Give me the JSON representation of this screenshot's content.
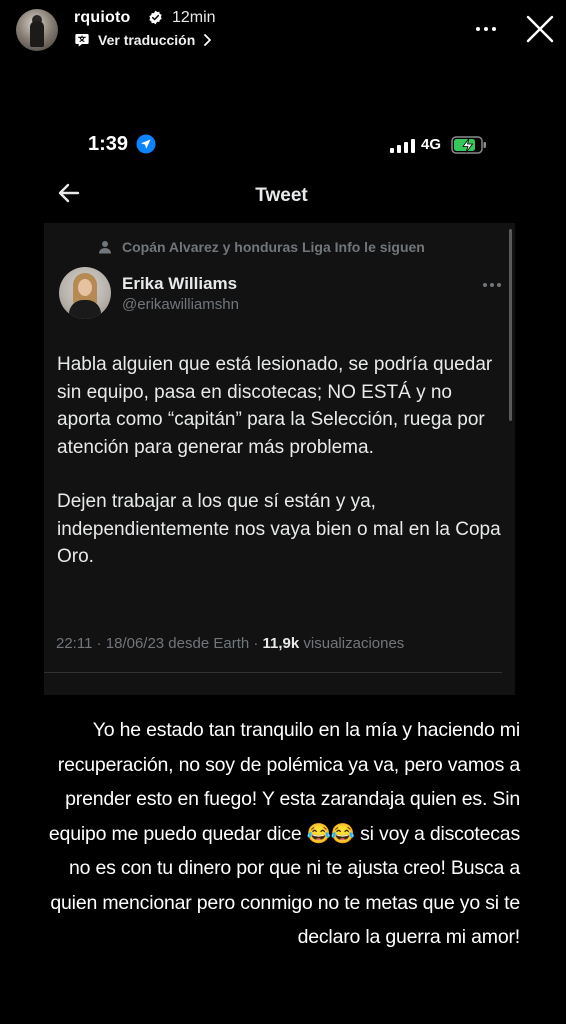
{
  "story": {
    "username": "rquioto",
    "time": "12min",
    "translate_label": "Ver traducción",
    "icons": [
      "verified-icon",
      "translate-icon",
      "chevron-right-icon",
      "more-icon",
      "close-icon"
    ]
  },
  "screenshot": {
    "status_bar": {
      "time": "1:39",
      "network": "4G"
    },
    "nav": {
      "title": "Tweet"
    },
    "tweet": {
      "social_context": "Copán Alvarez y honduras Liga Info le siguen",
      "author_name": "Erika Williams",
      "author_handle": "@erikawilliamshn",
      "body": [
        "Habla alguien que está lesionado, se podría quedar sin equipo, pasa en discotecas; NO ESTÁ y no aporta como “capitán” para la Selección, ruega por atención para generar más problema.",
        "Dejen trabajar a los que sí están y ya, independientemente nos vaya bien o mal en la Copa Oro."
      ],
      "meta_datetime": "22:11 · 18/06/23 desde Earth · ",
      "meta_views_count": "11,9k",
      "meta_views_label": " visualizaciones"
    }
  },
  "caption_lines": [
    "Yo he estado tan tranquilo en la mía y haciendo mi",
    "recuperación, no soy de polémica ya va, pero vamos a",
    "prender esto en fuego! Y esta zarandaja quien es. Sin",
    "equipo me puedo quedar dice 😂😂 si voy a discotecas",
    "no es con tu dinero por que ni te ajusta creo! Busca a",
    "quien mencionar pero conmigo no te metas que yo si te",
    "declaro la guerra mi amor!"
  ],
  "colors": {
    "background": "#000000",
    "tweet_card": "#121212",
    "secondary_text": "#71767b",
    "battery_green": "#34c759",
    "location_blue": "#0a84ff"
  }
}
